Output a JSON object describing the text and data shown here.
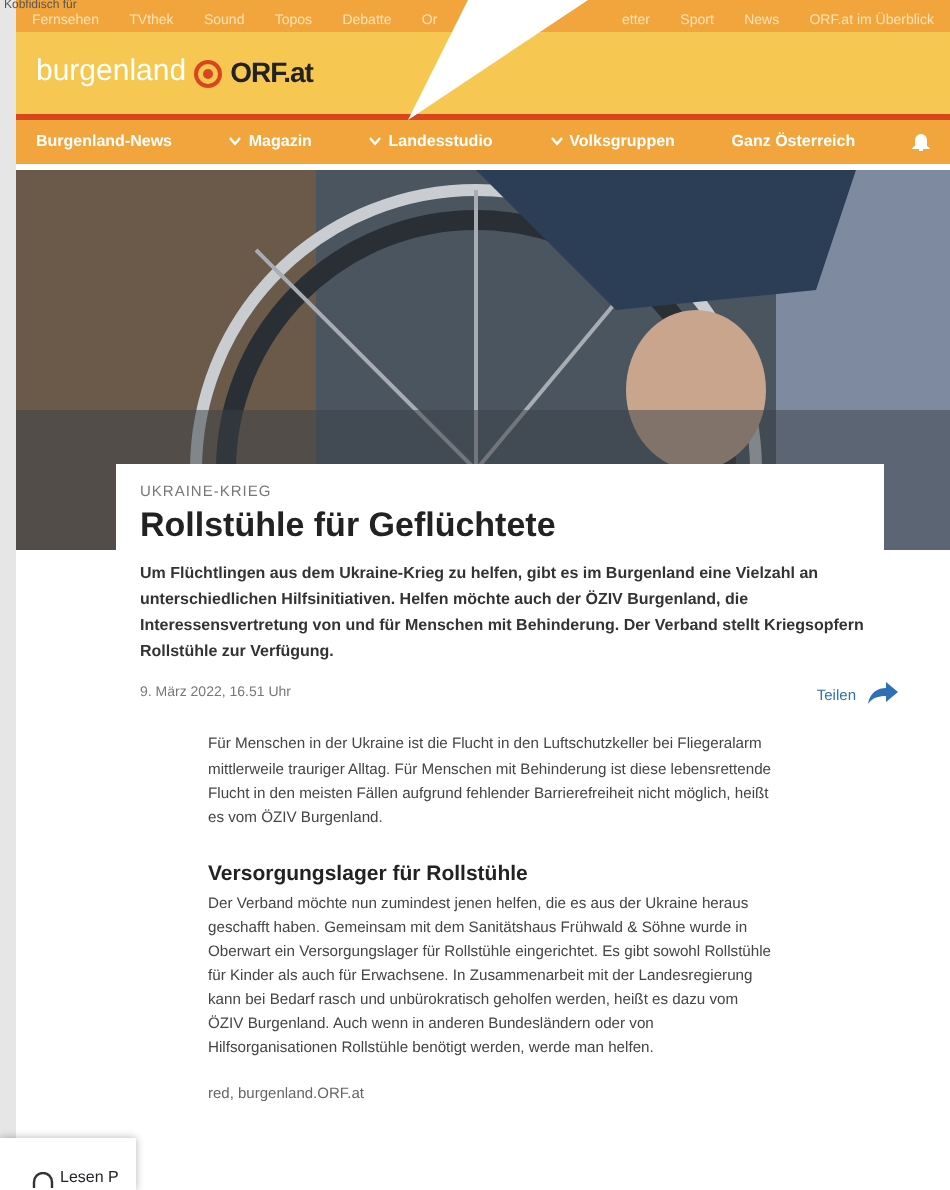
{
  "overlay_text": "Kobfidisch für",
  "top_nav": [
    {
      "label": "Fernsehen"
    },
    {
      "label": "TVthek"
    },
    {
      "label": "Sound"
    },
    {
      "label": "Topos"
    },
    {
      "label": "Debatte"
    },
    {
      "label": "Or"
    },
    {
      "label": "etter"
    },
    {
      "label": "Sport"
    },
    {
      "label": "News"
    },
    {
      "label": "ORF.at im Überblick"
    }
  ],
  "brand": {
    "region": "burgenland",
    "name": "ORF.at"
  },
  "main_nav": [
    {
      "label": "Burgenland-News",
      "dropdown": false
    },
    {
      "label": "Magazin",
      "dropdown": true
    },
    {
      "label": "Landesstudio",
      "dropdown": true
    },
    {
      "label": "Volksgruppen",
      "dropdown": true
    },
    {
      "label": "Ganz Österreich",
      "dropdown": false
    }
  ],
  "article": {
    "kicker": "UKRAINE-KRIEG",
    "title": "Rollstühle für Geflüchtete",
    "lead": "Um Flüchtlingen aus dem Ukraine-Krieg zu helfen, gibt es im Burgenland eine Vielzahl an unterschiedlichen Hilfsinitiativen. Helfen möchte auch der ÖZIV Burgenland, die Interessensvertretung von und für Menschen mit Behinderung. Der Verband stellt Kriegsopfern Rollstühle zur Verfügung.",
    "date": "9. März 2022, 16.51 Uhr",
    "share": "Teilen",
    "body": [
      {
        "kind": "paragraph",
        "text": "Für Menschen in der Ukraine ist die Flucht in den Luftschutzkeller bei Fliegeralarm mittlerweile trauriger Alltag. Für Menschen mit Behinderung ist diese lebensrettende Flucht in den meisten Fällen aufgrund fehlender Barrierefreiheit nicht möglich, heißt es vom ÖZIV Burgenland."
      },
      {
        "kind": "heading",
        "text": "Versorgungslager für Rollstühle"
      },
      {
        "kind": "paragraph",
        "text": "Der Verband möchte nun zumindest jenen helfen, die es aus der Ukraine heraus geschafft haben. Gemeinsam mit dem Sanitätshaus Frühwald & Söhne wurde in Oberwart ein Versorgungslager für Rollstühle eingerichtet. Es gibt sowohl Rollstühle für Kinder als auch für Erwachsene. In Zusammenarbeit mit der Landesregierung kann bei Bedarf rasch und unbürokratisch geholfen werden, heißt es dazu vom ÖZIV Burgenland. Auch wenn in anderen Bundesländern oder von Hilfsorganisationen Rollstühle benötigt werden, werde man helfen."
      }
    ],
    "credit": "red, burgenland.ORF.at"
  },
  "popup": {
    "label": "Lesen P"
  }
}
